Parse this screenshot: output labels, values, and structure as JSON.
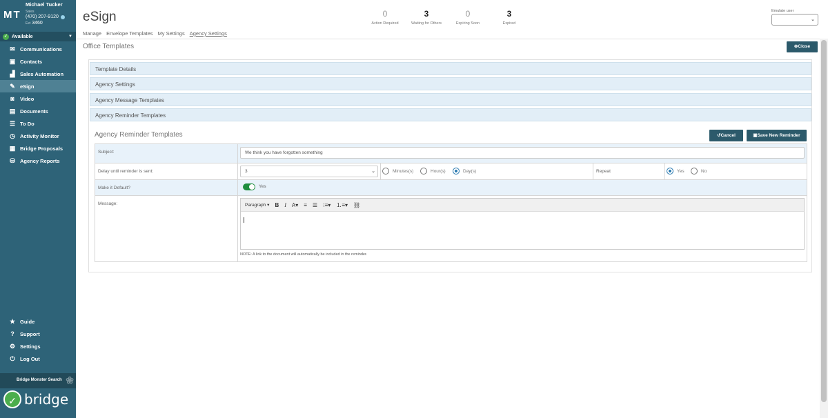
{
  "user": {
    "initials": "MT",
    "name": "Michael Tucker",
    "role": "Sales",
    "phone": "(470) 207-9120",
    "ext_label": "Ext",
    "ext": "3460"
  },
  "status": {
    "label": "Available"
  },
  "nav": [
    {
      "label": "Communications",
      "icon": "envelope-icon",
      "glyph": "✉"
    },
    {
      "label": "Contacts",
      "icon": "contact-card-icon",
      "glyph": "▣"
    },
    {
      "label": "Sales Automation",
      "icon": "chart-icon",
      "glyph": "▟"
    },
    {
      "label": "eSign",
      "icon": "edit-icon",
      "glyph": "✎"
    },
    {
      "label": "Video",
      "icon": "camera-icon",
      "glyph": "◙"
    },
    {
      "label": "Documents",
      "icon": "document-box-icon",
      "glyph": "▤"
    },
    {
      "label": "To Do",
      "icon": "list-icon",
      "glyph": "☰"
    },
    {
      "label": "Activity Monitor",
      "icon": "dashboard-icon",
      "glyph": "◷"
    },
    {
      "label": "Bridge Proposals",
      "icon": "table-icon",
      "glyph": "▦"
    },
    {
      "label": "Agency Reports",
      "icon": "database-icon",
      "glyph": "⛁"
    }
  ],
  "nav_bottom": [
    {
      "label": "Guide",
      "icon": "star-icon",
      "glyph": "★"
    },
    {
      "label": "Support",
      "icon": "question-icon",
      "glyph": "?"
    },
    {
      "label": "Settings",
      "icon": "gear-icon",
      "glyph": "⚙"
    },
    {
      "label": "Log Out",
      "icon": "power-icon",
      "glyph": "⏻"
    }
  ],
  "monster_search": "Bridge Monster Search",
  "logo_text": "bridge",
  "app_title": "eSign",
  "subnav": [
    "Manage",
    "Envelope Templates",
    "My Settings",
    "Agency Settings"
  ],
  "stats": [
    {
      "value": "0",
      "label": "Action Required"
    },
    {
      "value": "3",
      "label": "Waiting for Others"
    },
    {
      "value": "0",
      "label": "Expiring Soon"
    },
    {
      "value": "3",
      "label": "Expired"
    }
  ],
  "emulate_label": "Emulate user",
  "page_title": "Office Templates",
  "close_label": "Close",
  "accordion": [
    "Template Details",
    "Agency Settings",
    "Agency Message Templates",
    "Agency Reminder Templates"
  ],
  "section_title": "Agency Reminder Templates",
  "buttons": {
    "cancel": "Cancel",
    "save": "Save New Reminder"
  },
  "form": {
    "subject_label": "Subject:",
    "subject_value": "We think you have forgotten something",
    "delay_label": "Delay until reminder is sent:",
    "delay_value": "3",
    "units": [
      "Minutes(s)",
      "Hour(s)",
      "Day(s)"
    ],
    "units_selected": "Day(s)",
    "repeat_label": "Repeat",
    "repeat_yes": "Yes",
    "repeat_no": "No",
    "default_label": "Make it Default?",
    "default_value": "Yes",
    "message_label": "Message:",
    "editor_format": "Paragraph",
    "note": "NOTE: A link to the document will automatically be included in the reminder."
  },
  "colors": {
    "sidebar": "#2e6378",
    "button": "#2c5a6b",
    "accordion": "#e2eef7",
    "toggle_on": "#1e8e3e"
  }
}
